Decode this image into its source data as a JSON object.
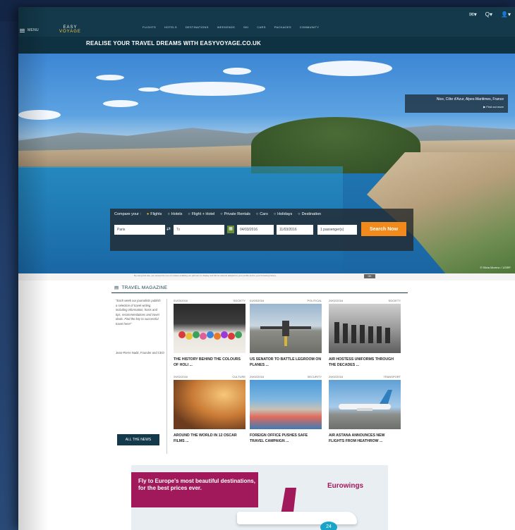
{
  "nav": {
    "menu_label": "MENU",
    "logo_line1": "EASY",
    "logo_line2": "VOYAGE",
    "links": [
      "FLIGHTS",
      "HOTELS",
      "DESTINATIONS",
      "WEEKENDS",
      "SKI",
      "CARS",
      "PACKAGES",
      "COMMUNITY"
    ],
    "right": {
      "mail": "✉▾",
      "search": "Q▾",
      "user": "👤▾"
    }
  },
  "tagline": "REALISE YOUR TRAVEL DREAMS WITH EASYVOYAGE.CO.UK",
  "hero": {
    "location": "Nice, Côte d'Azur, Alpes-Maritimes, France",
    "find_more": "▶ Find out more",
    "credit": "© Silvia Moreno / 123RF"
  },
  "search": {
    "compare_label": "Compare your :",
    "options": [
      "Flights",
      "Hotels",
      "Flight + Hotel",
      "Private Rentals",
      "Cars",
      "Holidays",
      "Destination"
    ],
    "from_value": "Paris",
    "to_placeholder": "To",
    "depart": "04/03/2016",
    "return": "11/03/2016",
    "passengers": "1 passenger(s)",
    "button": "Search Now"
  },
  "cookie": {
    "text": "By using this site, you accept the use of cookies enabling our partners to display and bid for adverts adapted to your profile and to your browsing history.",
    "ok": "OK"
  },
  "magazine": {
    "title": "TRAVEL MAGAZINE",
    "quote": "\"Each week our journalists publish a selection of travel writing including information, hosts and tips, recommendations and travel deals. Find the key to successful travel here!\"",
    "author": "Jean-Pierre Nadir, Founder and CEO",
    "all_news": "ALL THE NEWS",
    "articles": [
      {
        "date": "01/03/2016",
        "cat": "SOCIETY",
        "title": "THE HISTORY BEHIND THE COLOURS OF HOLI ..."
      },
      {
        "date": "01/03/2016",
        "cat": "POLITICAL",
        "title": "US SENATOR TO BATTLE LEGROOM ON PLANES ..."
      },
      {
        "date": "29/02/2016",
        "cat": "SOCIETY",
        "title": "AIR HOSTESS UNIFORMS THROUGH THE DECADES ..."
      },
      {
        "date": "29/02/2016",
        "cat": "CULTURE",
        "title": "AROUND THE WORLD IN 12 OSCAR FILMS ..."
      },
      {
        "date": "29/02/2016",
        "cat": "SECURITY",
        "title": "FOREIGN OFFICE PUSHES SAFE TRAVEL CAMPAIGN ..."
      },
      {
        "date": "29/02/2016",
        "cat": "TRANSPORT",
        "title": "AIR ASTANA ANNOUNCES NEW FLIGHTS FROM HEATHROW ..."
      }
    ]
  },
  "ad": {
    "text": "Fly to Europe's most beautiful destinations, for the best prices ever.",
    "brand": "Eurowings",
    "price": "24"
  }
}
